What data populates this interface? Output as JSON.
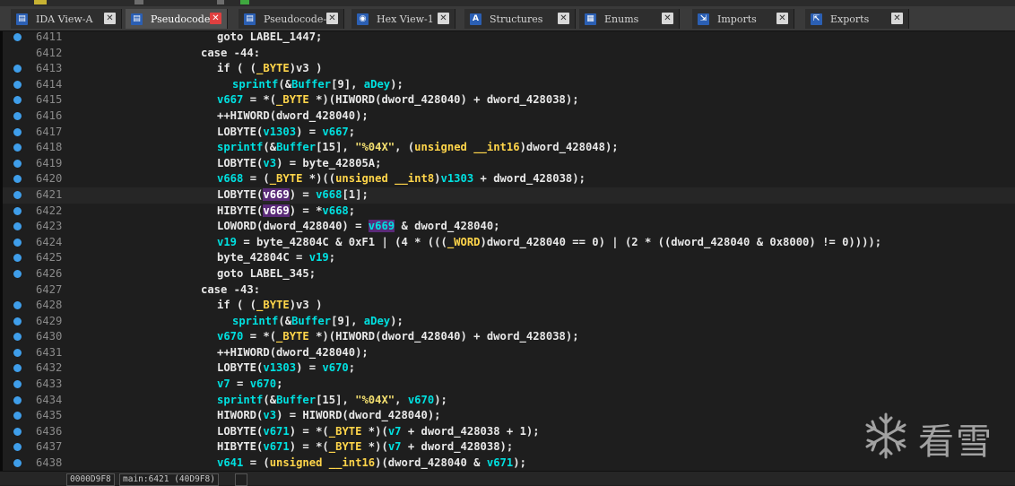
{
  "tabs": [
    {
      "label": "IDA View-A",
      "icon": "ida-view-icon",
      "active": false,
      "icon_color": "#2b5fb3",
      "glyph": "▤"
    },
    {
      "label": "Pseudocode-B",
      "icon": "pseudocode-icon",
      "active": true,
      "icon_color": "#2b5fb3",
      "glyph": "▤"
    },
    {
      "label": "Pseudocode-A",
      "icon": "pseudocode-icon",
      "active": false,
      "icon_color": "#2b5fb3",
      "glyph": "▤"
    },
    {
      "label": "Hex View-1",
      "icon": "hex-view-icon",
      "active": false,
      "icon_color": "#2b5fb3",
      "glyph": "◉"
    },
    {
      "label": "Structures",
      "icon": "structures-icon",
      "active": false,
      "icon_color": "#2b5fb3",
      "glyph": "A"
    },
    {
      "label": "Enums",
      "icon": "enums-icon",
      "active": false,
      "icon_color": "#2b5fb3",
      "glyph": "▦"
    },
    {
      "label": "Imports",
      "icon": "imports-icon",
      "active": false,
      "icon_color": "#2b5fb3",
      "glyph": "⇲"
    },
    {
      "label": "Exports",
      "icon": "exports-icon",
      "active": false,
      "icon_color": "#2b5fb3",
      "glyph": "⇱"
    }
  ],
  "close_glyph": "✕",
  "colors": {
    "background": "#1e1e1e",
    "line_number": "#8a8a8a",
    "breakpoint_dot": "#3f9eea",
    "keyword": "#00e0e0",
    "identifier": "#e8e8e8",
    "type": "#ffd54a",
    "string": "#f4e070",
    "highlight": "#5a2a78"
  },
  "current_line": "6421",
  "lines": [
    {
      "no": "6411",
      "dot": true,
      "t": [
        [
          "n",
          "goto LABEL_1447;"
        ]
      ],
      "indent": 1
    },
    {
      "no": "6412",
      "dot": false,
      "t": [
        [
          "n",
          "case -44:"
        ]
      ],
      "indent": 0
    },
    {
      "no": "6413",
      "dot": true,
      "t": [
        [
          "n",
          "if ( ("
        ],
        [
          "y",
          "_BYTE"
        ],
        [
          "n",
          ")v3 )"
        ]
      ],
      "indent": 1
    },
    {
      "no": "6414",
      "dot": true,
      "t": [
        [
          "c",
          "sprintf"
        ],
        [
          "n",
          "(&"
        ],
        [
          "c",
          "Buffer"
        ],
        [
          "n",
          "[9], "
        ],
        [
          "c",
          "aDey"
        ],
        [
          "n",
          ");"
        ]
      ],
      "indent": 2
    },
    {
      "no": "6415",
      "dot": true,
      "t": [
        [
          "c",
          "v667"
        ],
        [
          "n",
          " = *("
        ],
        [
          "y",
          "_BYTE"
        ],
        [
          "n",
          " *)(HIWORD(dword_428040) + dword_428038);"
        ]
      ],
      "indent": 1
    },
    {
      "no": "6416",
      "dot": true,
      "t": [
        [
          "n",
          "++HIWORD(dword_428040);"
        ]
      ],
      "indent": 1
    },
    {
      "no": "6417",
      "dot": true,
      "t": [
        [
          "n",
          "LOBYTE("
        ],
        [
          "c",
          "v1303"
        ],
        [
          "n",
          ") = "
        ],
        [
          "c",
          "v667"
        ],
        [
          "n",
          ";"
        ]
      ],
      "indent": 1
    },
    {
      "no": "6418",
      "dot": true,
      "t": [
        [
          "c",
          "sprintf"
        ],
        [
          "n",
          "(&"
        ],
        [
          "c",
          "Buffer"
        ],
        [
          "n",
          "[15], "
        ],
        [
          "s",
          "\"%04X\""
        ],
        [
          "n",
          ", ("
        ],
        [
          "y",
          "unsigned __int16"
        ],
        [
          "n",
          ")dword_428048);"
        ]
      ],
      "indent": 1
    },
    {
      "no": "6419",
      "dot": true,
      "t": [
        [
          "n",
          "LOBYTE("
        ],
        [
          "c",
          "v3"
        ],
        [
          "n",
          ") = byte_42805A;"
        ]
      ],
      "indent": 1
    },
    {
      "no": "6420",
      "dot": true,
      "t": [
        [
          "c",
          "v668"
        ],
        [
          "n",
          " = ("
        ],
        [
          "y",
          "_BYTE"
        ],
        [
          "n",
          " *)(("
        ],
        [
          "y",
          "unsigned __int8"
        ],
        [
          "n",
          ")"
        ],
        [
          "c",
          "v1303"
        ],
        [
          "n",
          " + dword_428038);"
        ]
      ],
      "indent": 1
    },
    {
      "no": "6421",
      "dot": true,
      "t": [
        [
          "n",
          "LOBYTE("
        ],
        [
          "h",
          "v669"
        ],
        [
          "n",
          ") = "
        ],
        [
          "c",
          "v668"
        ],
        [
          "n",
          "[1];"
        ]
      ],
      "indent": 1
    },
    {
      "no": "6422",
      "dot": true,
      "t": [
        [
          "n",
          "HIBYTE("
        ],
        [
          "h",
          "v669"
        ],
        [
          "n",
          ") = *"
        ],
        [
          "c",
          "v668"
        ],
        [
          "n",
          ";"
        ]
      ],
      "indent": 1
    },
    {
      "no": "6423",
      "dot": true,
      "t": [
        [
          "n",
          "LOWORD(dword_428040) = "
        ],
        [
          "h2",
          "v669"
        ],
        [
          "n",
          " & dword_428040;"
        ]
      ],
      "indent": 1
    },
    {
      "no": "6424",
      "dot": true,
      "t": [
        [
          "c",
          "v19"
        ],
        [
          "n",
          " = byte_42804C & 0xF1 | (4 * ((("
        ],
        [
          "y",
          "_WORD"
        ],
        [
          "n",
          ")dword_428040 == 0) | (2 * ((dword_428040 & 0x8000) != 0))));"
        ]
      ],
      "indent": 1
    },
    {
      "no": "6425",
      "dot": true,
      "t": [
        [
          "n",
          "byte_42804C = "
        ],
        [
          "c",
          "v19"
        ],
        [
          "n",
          ";"
        ]
      ],
      "indent": 1
    },
    {
      "no": "6426",
      "dot": true,
      "t": [
        [
          "n",
          "goto LABEL_345;"
        ]
      ],
      "indent": 1
    },
    {
      "no": "6427",
      "dot": false,
      "t": [
        [
          "n",
          "case -43:"
        ]
      ],
      "indent": 0
    },
    {
      "no": "6428",
      "dot": true,
      "t": [
        [
          "n",
          "if ( ("
        ],
        [
          "y",
          "_BYTE"
        ],
        [
          "n",
          ")v3 )"
        ]
      ],
      "indent": 1
    },
    {
      "no": "6429",
      "dot": true,
      "t": [
        [
          "c",
          "sprintf"
        ],
        [
          "n",
          "(&"
        ],
        [
          "c",
          "Buffer"
        ],
        [
          "n",
          "[9], "
        ],
        [
          "c",
          "aDey"
        ],
        [
          "n",
          ");"
        ]
      ],
      "indent": 2
    },
    {
      "no": "6430",
      "dot": true,
      "t": [
        [
          "c",
          "v670"
        ],
        [
          "n",
          " = *("
        ],
        [
          "y",
          "_BYTE"
        ],
        [
          "n",
          " *)(HIWORD(dword_428040) + dword_428038);"
        ]
      ],
      "indent": 1
    },
    {
      "no": "6431",
      "dot": true,
      "t": [
        [
          "n",
          "++HIWORD(dword_428040);"
        ]
      ],
      "indent": 1
    },
    {
      "no": "6432",
      "dot": true,
      "t": [
        [
          "n",
          "LOBYTE("
        ],
        [
          "c",
          "v1303"
        ],
        [
          "n",
          ") = "
        ],
        [
          "c",
          "v670"
        ],
        [
          "n",
          ";"
        ]
      ],
      "indent": 1
    },
    {
      "no": "6433",
      "dot": true,
      "t": [
        [
          "c",
          "v7"
        ],
        [
          "n",
          " = "
        ],
        [
          "c",
          "v670"
        ],
        [
          "n",
          ";"
        ]
      ],
      "indent": 1
    },
    {
      "no": "6434",
      "dot": true,
      "t": [
        [
          "c",
          "sprintf"
        ],
        [
          "n",
          "(&"
        ],
        [
          "c",
          "Buffer"
        ],
        [
          "n",
          "[15], "
        ],
        [
          "s",
          "\"%04X\""
        ],
        [
          "n",
          ", "
        ],
        [
          "c",
          "v670"
        ],
        [
          "n",
          ");"
        ]
      ],
      "indent": 1
    },
    {
      "no": "6435",
      "dot": true,
      "t": [
        [
          "n",
          "HIWORD("
        ],
        [
          "c",
          "v3"
        ],
        [
          "n",
          ") = HIWORD(dword_428040);"
        ]
      ],
      "indent": 1
    },
    {
      "no": "6436",
      "dot": true,
      "t": [
        [
          "n",
          "LOBYTE("
        ],
        [
          "c",
          "v671"
        ],
        [
          "n",
          ") = *("
        ],
        [
          "y",
          "_BYTE"
        ],
        [
          "n",
          " *)("
        ],
        [
          "c",
          "v7"
        ],
        [
          "n",
          " + dword_428038 + 1);"
        ]
      ],
      "indent": 1
    },
    {
      "no": "6437",
      "dot": true,
      "t": [
        [
          "n",
          "HIBYTE("
        ],
        [
          "c",
          "v671"
        ],
        [
          "n",
          ") = *("
        ],
        [
          "y",
          "_BYTE"
        ],
        [
          "n",
          " *)("
        ],
        [
          "c",
          "v7"
        ],
        [
          "n",
          " + dword_428038);"
        ]
      ],
      "indent": 1
    },
    {
      "no": "6438",
      "dot": true,
      "t": [
        [
          "c",
          "v641"
        ],
        [
          "n",
          " = ("
        ],
        [
          "y",
          "unsigned __int16"
        ],
        [
          "n",
          ")(dword_428040 & "
        ],
        [
          "c",
          "v671"
        ],
        [
          "n",
          ");"
        ]
      ],
      "indent": 1
    }
  ],
  "status": {
    "address": "0000D9F8",
    "location": "main:6421 (40D9F8)"
  },
  "watermark": {
    "text": "看雪",
    "icon": "snowflake-icon"
  }
}
